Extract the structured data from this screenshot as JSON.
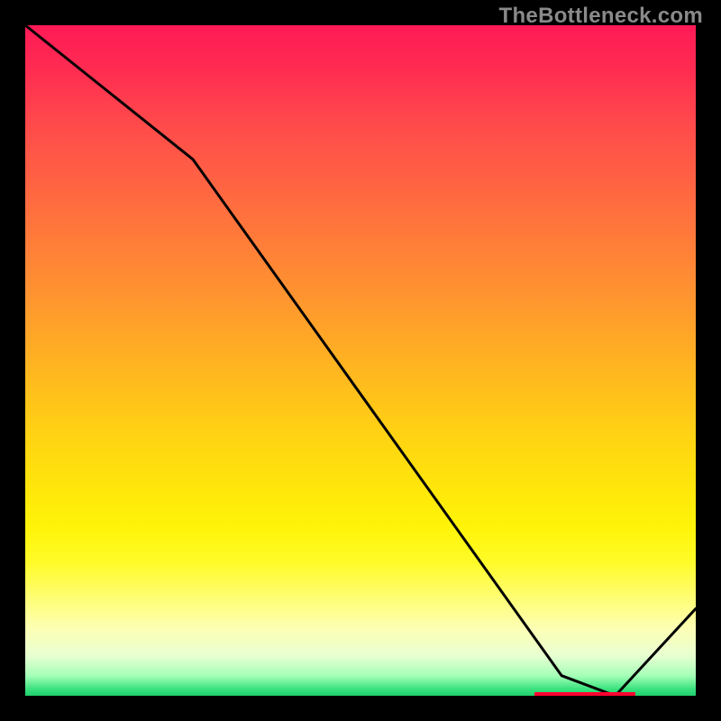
{
  "watermark": "TheBottleneck.com",
  "colors": {
    "frame": "#000000",
    "line": "#000000",
    "marker": "#ff0030",
    "watermark_text": "#8a8a8a"
  },
  "chart_data": {
    "type": "line",
    "title": "",
    "xlabel": "",
    "ylabel": "",
    "xlim": [
      0,
      100
    ],
    "ylim": [
      0,
      100
    ],
    "series": [
      {
        "name": "curve",
        "x": [
          0,
          25,
          80,
          88,
          100
        ],
        "values": [
          100,
          80,
          3,
          0,
          13
        ]
      }
    ],
    "marker": {
      "x_start": 76,
      "x_end": 91,
      "y": 0
    },
    "gradient_stops": [
      {
        "pct": 0,
        "color": "#ff1a56"
      },
      {
        "pct": 15,
        "color": "#ff4b4b"
      },
      {
        "pct": 40,
        "color": "#ff9330"
      },
      {
        "pct": 62,
        "color": "#ffd512"
      },
      {
        "pct": 80,
        "color": "#fffb28"
      },
      {
        "pct": 94,
        "color": "#e8ffd1"
      },
      {
        "pct": 100,
        "color": "#1ecf6d"
      }
    ]
  }
}
